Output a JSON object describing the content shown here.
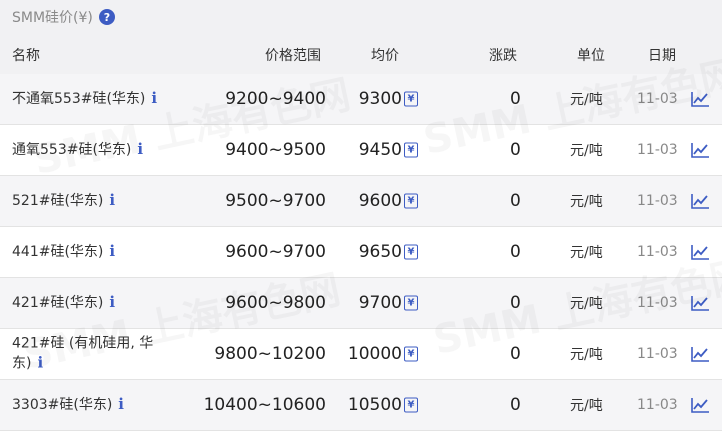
{
  "header": {
    "title": "SMM硅价(¥)",
    "help_icon": "question-circle-icon"
  },
  "columns": {
    "name": "名称",
    "range": "价格范围",
    "avg": "均价",
    "change": "涨跌",
    "unit": "单位",
    "date": "日期"
  },
  "watermark": "SMM 上海有色网",
  "rows": [
    {
      "name": "不通氧553#硅(华东)",
      "range": "9200~9400",
      "avg": "9300",
      "change": "0",
      "unit": "元/吨",
      "date": "11-03"
    },
    {
      "name": "通氧553#硅(华东)",
      "range": "9400~9500",
      "avg": "9450",
      "change": "0",
      "unit": "元/吨",
      "date": "11-03"
    },
    {
      "name": "521#硅(华东)",
      "range": "9500~9700",
      "avg": "9600",
      "change": "0",
      "unit": "元/吨",
      "date": "11-03"
    },
    {
      "name": "441#硅(华东)",
      "range": "9600~9700",
      "avg": "9650",
      "change": "0",
      "unit": "元/吨",
      "date": "11-03"
    },
    {
      "name": "421#硅(华东)",
      "range": "9600~9800",
      "avg": "9700",
      "change": "0",
      "unit": "元/吨",
      "date": "11-03"
    },
    {
      "name": "421#硅 (有机硅用, 华东)",
      "range": "9800~10200",
      "avg": "10000",
      "change": "0",
      "unit": "元/吨",
      "date": "11-03"
    },
    {
      "name": "3303#硅(华东)",
      "range": "10400~10600",
      "avg": "10500",
      "change": "0",
      "unit": "元/吨",
      "date": "11-03"
    }
  ],
  "icons": {
    "info": "info-icon",
    "yen": "yen-icon",
    "trend": "trend-chart-icon"
  },
  "colors": {
    "accent": "#3d5cc3",
    "header_bg": "#f1f1f3",
    "row_alt_bg": "#f5f5f7"
  }
}
